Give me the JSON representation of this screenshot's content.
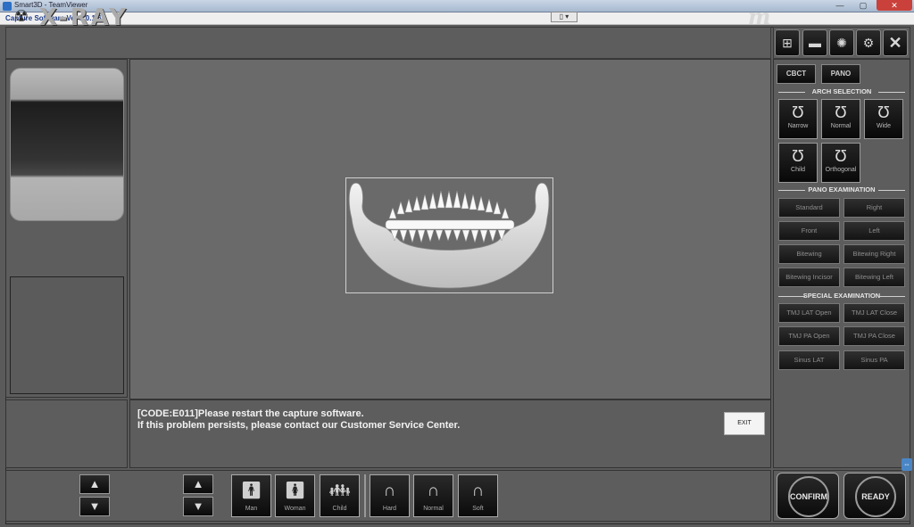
{
  "teamviewer": {
    "window_title": "Smart3D - TeamViewer",
    "tab_icon": "▯ ▾",
    "min": "—",
    "max": "▢",
    "close": "✕"
  },
  "capture": {
    "title": "Capture Software Ver 2.0.1.6"
  },
  "header": {
    "logo_text": "X-RAY",
    "brand_mark": "m"
  },
  "toolbar": {
    "icons": [
      "add-scan-icon",
      "tray-icon",
      "bulb-icon",
      "settings-icon",
      "close-icon"
    ],
    "close_glyph": "✕"
  },
  "modes": {
    "cbct": "CBCT",
    "pano": "PANO"
  },
  "arch_selection": {
    "heading": "ARCH SELECTION",
    "items": [
      "Narrow",
      "Normal",
      "Wide",
      "Child",
      "Orthogonal"
    ]
  },
  "pano_examination": {
    "heading": "PANO EXAMINATION",
    "items": [
      "Standard",
      "Right",
      "Front",
      "Left",
      "Bitewing",
      "Bitewing Right",
      "Bitewing Incisor",
      "Bitewing Left"
    ]
  },
  "special_examination": {
    "heading": "SPECIAL EXAMINATION",
    "items": [
      "TMJ LAT Open",
      "TMJ LAT Close",
      "TMJ PA Open",
      "TMJ PA Close",
      "Sinus LAT",
      "Sinus PA"
    ]
  },
  "message": {
    "line1": "[CODE:E011]Please restart the capture software.",
    "line2": "If this problem persists, please contact our Customer Service Center.",
    "exit_label": "EXIT"
  },
  "patient": {
    "items": [
      "Man",
      "Woman",
      "Child"
    ]
  },
  "bite": {
    "items": [
      "Hard",
      "Normal",
      "Soft"
    ]
  },
  "actions": {
    "confirm": "CONFIRM",
    "ready": "READY"
  }
}
